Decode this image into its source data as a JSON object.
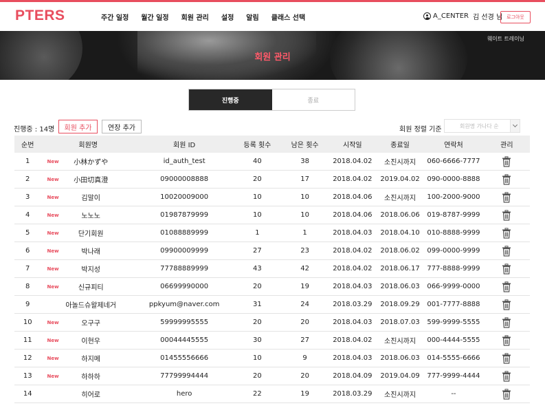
{
  "app": {
    "logo": "PTERS"
  },
  "nav": [
    {
      "label": "주간 일정"
    },
    {
      "label": "월간 일정"
    },
    {
      "label": "회원 관리"
    },
    {
      "label": "설정"
    },
    {
      "label": "알림"
    },
    {
      "label": "클래스 선택"
    }
  ],
  "user": {
    "center": "A_CENTER",
    "name": "김 선경 님",
    "logout": "로그아웃"
  },
  "banner": {
    "title": "회원 관리",
    "subtitle": "웨이트 트레이닝"
  },
  "tabs": [
    {
      "label": "진행중",
      "active": true
    },
    {
      "label": "종료",
      "active": false
    }
  ],
  "toolbar": {
    "count": "진행중 : 14명",
    "add_button": "회원 추가",
    "extend_button": "연장 추가",
    "sort_label": "회원 정렬 기준",
    "sort_value": "회원명 가나다 순"
  },
  "table": {
    "headers": [
      "순번",
      "회원명",
      "회원 ID",
      "등록 횟수",
      "남은 횟수",
      "시작일",
      "종료일",
      "연락처",
      "관리"
    ],
    "new_label": "New",
    "rows": [
      {
        "no": "1",
        "new": true,
        "name": "小林かずや",
        "id": "id_auth_test",
        "reg": "40",
        "left": "38",
        "start": "2018.04.02",
        "end": "소진시까지",
        "phone": "060-6666-7777"
      },
      {
        "no": "2",
        "new": true,
        "name": "小田切真澄",
        "id": "09000008888",
        "reg": "20",
        "left": "17",
        "start": "2018.04.02",
        "end": "2019.04.02",
        "phone": "090-0000-8888"
      },
      {
        "no": "3",
        "new": true,
        "name": "김말이",
        "id": "10020009000",
        "reg": "10",
        "left": "10",
        "start": "2018.04.06",
        "end": "소진시까지",
        "phone": "100-2000-9000"
      },
      {
        "no": "4",
        "new": true,
        "name": "노노노",
        "id": "01987879999",
        "reg": "10",
        "left": "10",
        "start": "2018.04.06",
        "end": "2018.06.06",
        "phone": "019-8787-9999"
      },
      {
        "no": "5",
        "new": true,
        "name": "단기회원",
        "id": "01088889999",
        "reg": "1",
        "left": "1",
        "start": "2018.04.03",
        "end": "2018.04.10",
        "phone": "010-8888-9999"
      },
      {
        "no": "6",
        "new": true,
        "name": "박나래",
        "id": "09900009999",
        "reg": "27",
        "left": "23",
        "start": "2018.04.02",
        "end": "2018.06.02",
        "phone": "099-0000-9999"
      },
      {
        "no": "7",
        "new": true,
        "name": "박지성",
        "id": "77788889999",
        "reg": "43",
        "left": "42",
        "start": "2018.04.02",
        "end": "2018.06.17",
        "phone": "777-8888-9999"
      },
      {
        "no": "8",
        "new": true,
        "name": "신규피티",
        "id": "06699990000",
        "reg": "20",
        "left": "19",
        "start": "2018.04.03",
        "end": "2018.06.03",
        "phone": "066-9999-0000"
      },
      {
        "no": "9",
        "new": false,
        "name": "아놀드슈왈제네거",
        "id": "ppkyum@naver.com",
        "reg": "31",
        "left": "24",
        "start": "2018.03.29",
        "end": "2018.09.29",
        "phone": "001-7777-8888"
      },
      {
        "no": "10",
        "new": true,
        "name": "오구구",
        "id": "59999995555",
        "reg": "20",
        "left": "20",
        "start": "2018.04.03",
        "end": "2018.07.03",
        "phone": "599-9999-5555"
      },
      {
        "no": "11",
        "new": true,
        "name": "이현우",
        "id": "00044445555",
        "reg": "30",
        "left": "27",
        "start": "2018.04.02",
        "end": "소진시까지",
        "phone": "000-4444-5555"
      },
      {
        "no": "12",
        "new": true,
        "name": "하지메",
        "id": "01455556666",
        "reg": "10",
        "left": "9",
        "start": "2018.04.03",
        "end": "2018.06.03",
        "phone": "014-5555-6666"
      },
      {
        "no": "13",
        "new": true,
        "name": "하하하",
        "id": "77799994444",
        "reg": "20",
        "left": "20",
        "start": "2018.04.09",
        "end": "2019.04.09",
        "phone": "777-9999-4444"
      },
      {
        "no": "14",
        "new": false,
        "name": "히어로",
        "id": "hero",
        "reg": "22",
        "left": "19",
        "start": "2018.03.29",
        "end": "소진시까지",
        "phone": "--"
      }
    ]
  },
  "colors": {
    "accent": "#e84d5e",
    "tab_active_bg": "#282828",
    "header_bg": "#eeeeee"
  },
  "icons": {
    "row_action": "trash-icon",
    "user": "user-circle-icon",
    "sort": "chevron-down-icon"
  }
}
